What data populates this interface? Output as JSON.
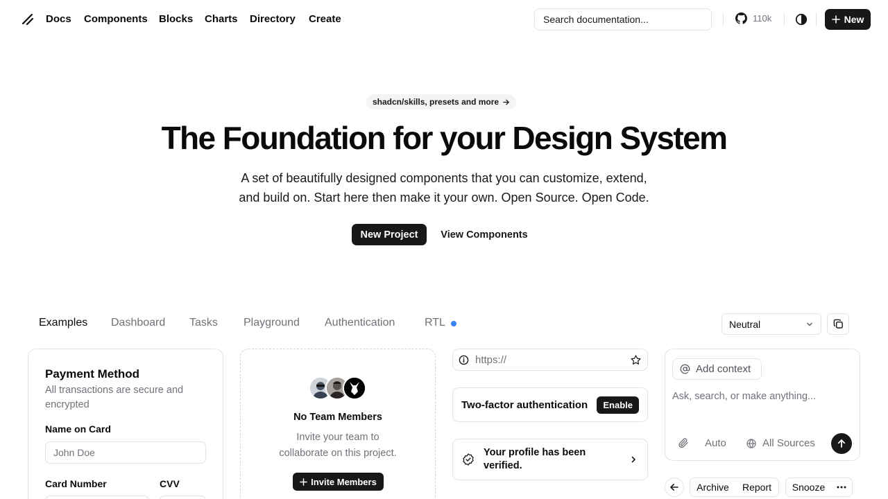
{
  "header": {
    "logo_icon": "slash-logo-icon",
    "nav": [
      "Docs",
      "Components",
      "Blocks",
      "Charts",
      "Directory",
      "Create"
    ],
    "search_placeholder": "Search documentation...",
    "github_stars": "110k",
    "new_button": "New"
  },
  "hero": {
    "announcement": "shadcn/skills, presets and more",
    "title": "The Foundation for your Design System",
    "subtitle_line1": "A set of beautifully designed components that you can customize, extend,",
    "subtitle_line2": "and build on. Start here then make it your own. Open Source. Open Code.",
    "primary_cta": "New Project",
    "secondary_cta": "View Components"
  },
  "tabs": {
    "items": [
      "Examples",
      "Dashboard",
      "Tasks",
      "Playground",
      "Authentication",
      "RTL"
    ],
    "active": "Examples",
    "theme_select": "Neutral"
  },
  "payment": {
    "title": "Payment Method",
    "description_line1": "All transactions are secure and",
    "description_line2": "encrypted",
    "name_label": "Name on Card",
    "name_placeholder": "John Doe",
    "card_number_label": "Card Number",
    "cvv_label": "CVV"
  },
  "team": {
    "title": "No Team Members",
    "description_line1": "Invite your team to",
    "description_line2": "collaborate on this project.",
    "invite_button": "Invite Members"
  },
  "url_bar": {
    "placeholder": "https://"
  },
  "twofa": {
    "label": "Two-factor authentication",
    "button": "Enable"
  },
  "verified": {
    "line1": "Your profile has been",
    "line2": "verified."
  },
  "assistant": {
    "context_button": "Add context",
    "prompt_placeholder": "Ask, search, or make anything...",
    "mode": "Auto",
    "sources": "All Sources"
  },
  "mail_toolbar": {
    "archive": "Archive",
    "report": "Report",
    "snooze": "Snooze"
  },
  "colors": {
    "primary": "#18181b",
    "border": "#e4e4e7",
    "muted": "#71717a",
    "accent_dot": "#3b82f6"
  }
}
